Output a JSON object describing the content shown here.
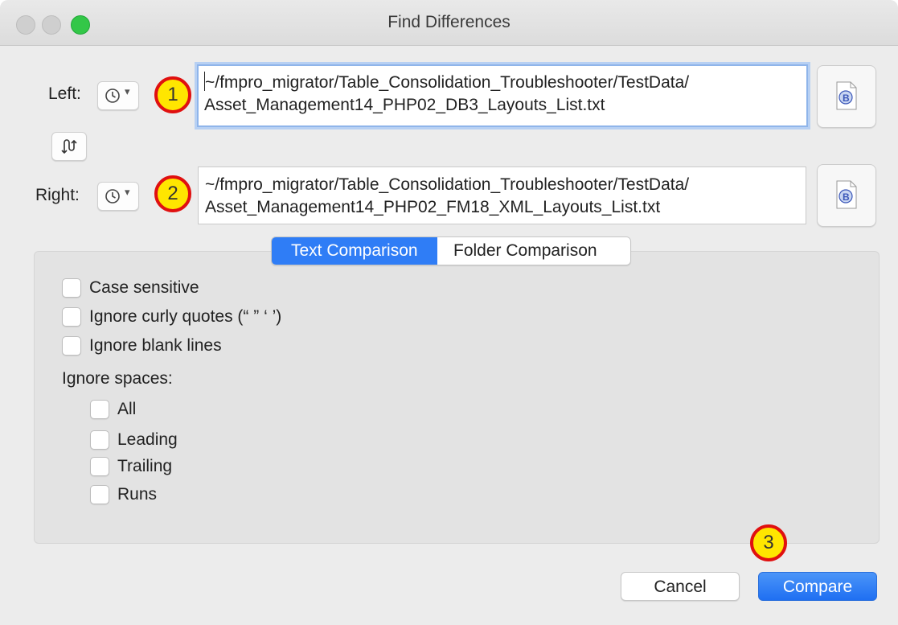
{
  "window": {
    "title": "Find Differences",
    "accent_color": "#2f7df6",
    "badge_color": "#ffe600",
    "badge_border_color": "#e01010"
  },
  "left": {
    "label": "Left:",
    "badge": "1",
    "path": "~/fmpro_migrator/Table_Consolidation_Troubleshooter/TestData/\nAsset_Management14_PHP02_DB3_Layouts_List.txt",
    "recent_icon": "clock-icon",
    "doc_icon": "bbedit-document-icon"
  },
  "swap": {
    "icon": "swap-arrows-icon"
  },
  "right": {
    "label": "Right:",
    "badge": "2",
    "path": "~/fmpro_migrator/Table_Consolidation_Troubleshooter/TestData/\nAsset_Management14_PHP02_FM18_XML_Layouts_List.txt",
    "recent_icon": "clock-icon",
    "doc_icon": "bbedit-document-icon"
  },
  "tabs": [
    {
      "label": "Text Comparison",
      "selected": true
    },
    {
      "label": "Folder Comparison",
      "selected": false
    }
  ],
  "options": {
    "case_sensitive": "Case sensitive",
    "ignore_curly_quotes": "Ignore curly quotes (“ ” ‘ ’)",
    "ignore_blank_lines": "Ignore blank lines",
    "ignore_spaces_label": "Ignore spaces:",
    "spaces": [
      "All",
      "Leading",
      "Trailing",
      "Runs"
    ]
  },
  "buttons": {
    "badge": "3",
    "cancel": "Cancel",
    "compare": "Compare"
  }
}
